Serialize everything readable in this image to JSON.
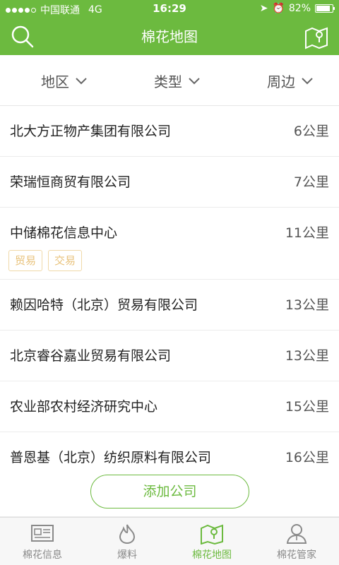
{
  "status": {
    "carrier": "中国联通",
    "network": "4G",
    "time": "16:29",
    "battery": "82%"
  },
  "header": {
    "title": "棉花地图",
    "search_icon": "search-icon",
    "map_icon": "map-icon"
  },
  "filters": [
    {
      "label": "地区"
    },
    {
      "label": "类型"
    },
    {
      "label": "周边"
    }
  ],
  "companies": [
    {
      "name": "北大方正物产集团有限公司",
      "distance": "6公里",
      "tags": []
    },
    {
      "name": "荣瑞恒商贸有限公司",
      "distance": "7公里",
      "tags": []
    },
    {
      "name": "中储棉花信息中心",
      "distance": "11公里",
      "tags": [
        "贸易",
        "交易"
      ]
    },
    {
      "name": "赖因哈特（北京）贸易有限公司",
      "distance": "13公里",
      "tags": []
    },
    {
      "name": "北京睿谷嘉业贸易有限公司",
      "distance": "13公里",
      "tags": []
    },
    {
      "name": "农业部农村经济研究中心",
      "distance": "15公里",
      "tags": []
    },
    {
      "name": "普恩基（北京）纺织原料有限公司",
      "distance": "16公里",
      "tags": []
    }
  ],
  "add_button": "添加公司",
  "tabs": [
    {
      "label": "棉花信息",
      "icon": "news-icon",
      "active": false
    },
    {
      "label": "爆料",
      "icon": "flame-icon",
      "active": false
    },
    {
      "label": "棉花地图",
      "icon": "map-icon",
      "active": true
    },
    {
      "label": "棉花管家",
      "icon": "person-icon",
      "active": false
    }
  ],
  "colors": {
    "brand": "#6cba3f",
    "tag_border": "#f0d9a8",
    "tag_text": "#e8c27b"
  }
}
